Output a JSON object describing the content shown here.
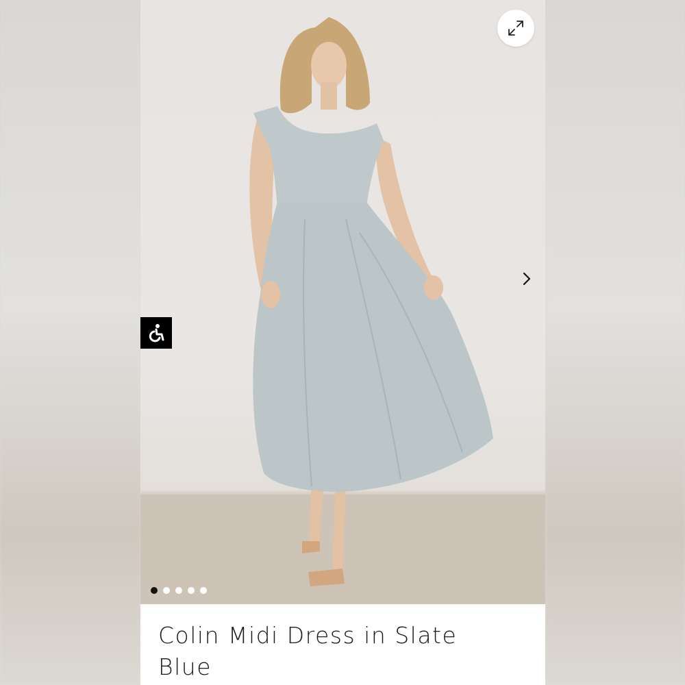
{
  "product": {
    "title": "Colin Midi Dress in Slate Blue"
  },
  "gallery": {
    "slide_count": 5,
    "active_slide": 1,
    "expand_icon": "expand-arrows-icon",
    "next_icon": "chevron-right-icon"
  },
  "accessibility": {
    "icon": "wheelchair-accessibility-icon"
  },
  "colors": {
    "dress": "#bcc5c8",
    "background": "#e8e5e2",
    "floor": "#cfc4b6",
    "title_text": "#1a1a1a"
  }
}
